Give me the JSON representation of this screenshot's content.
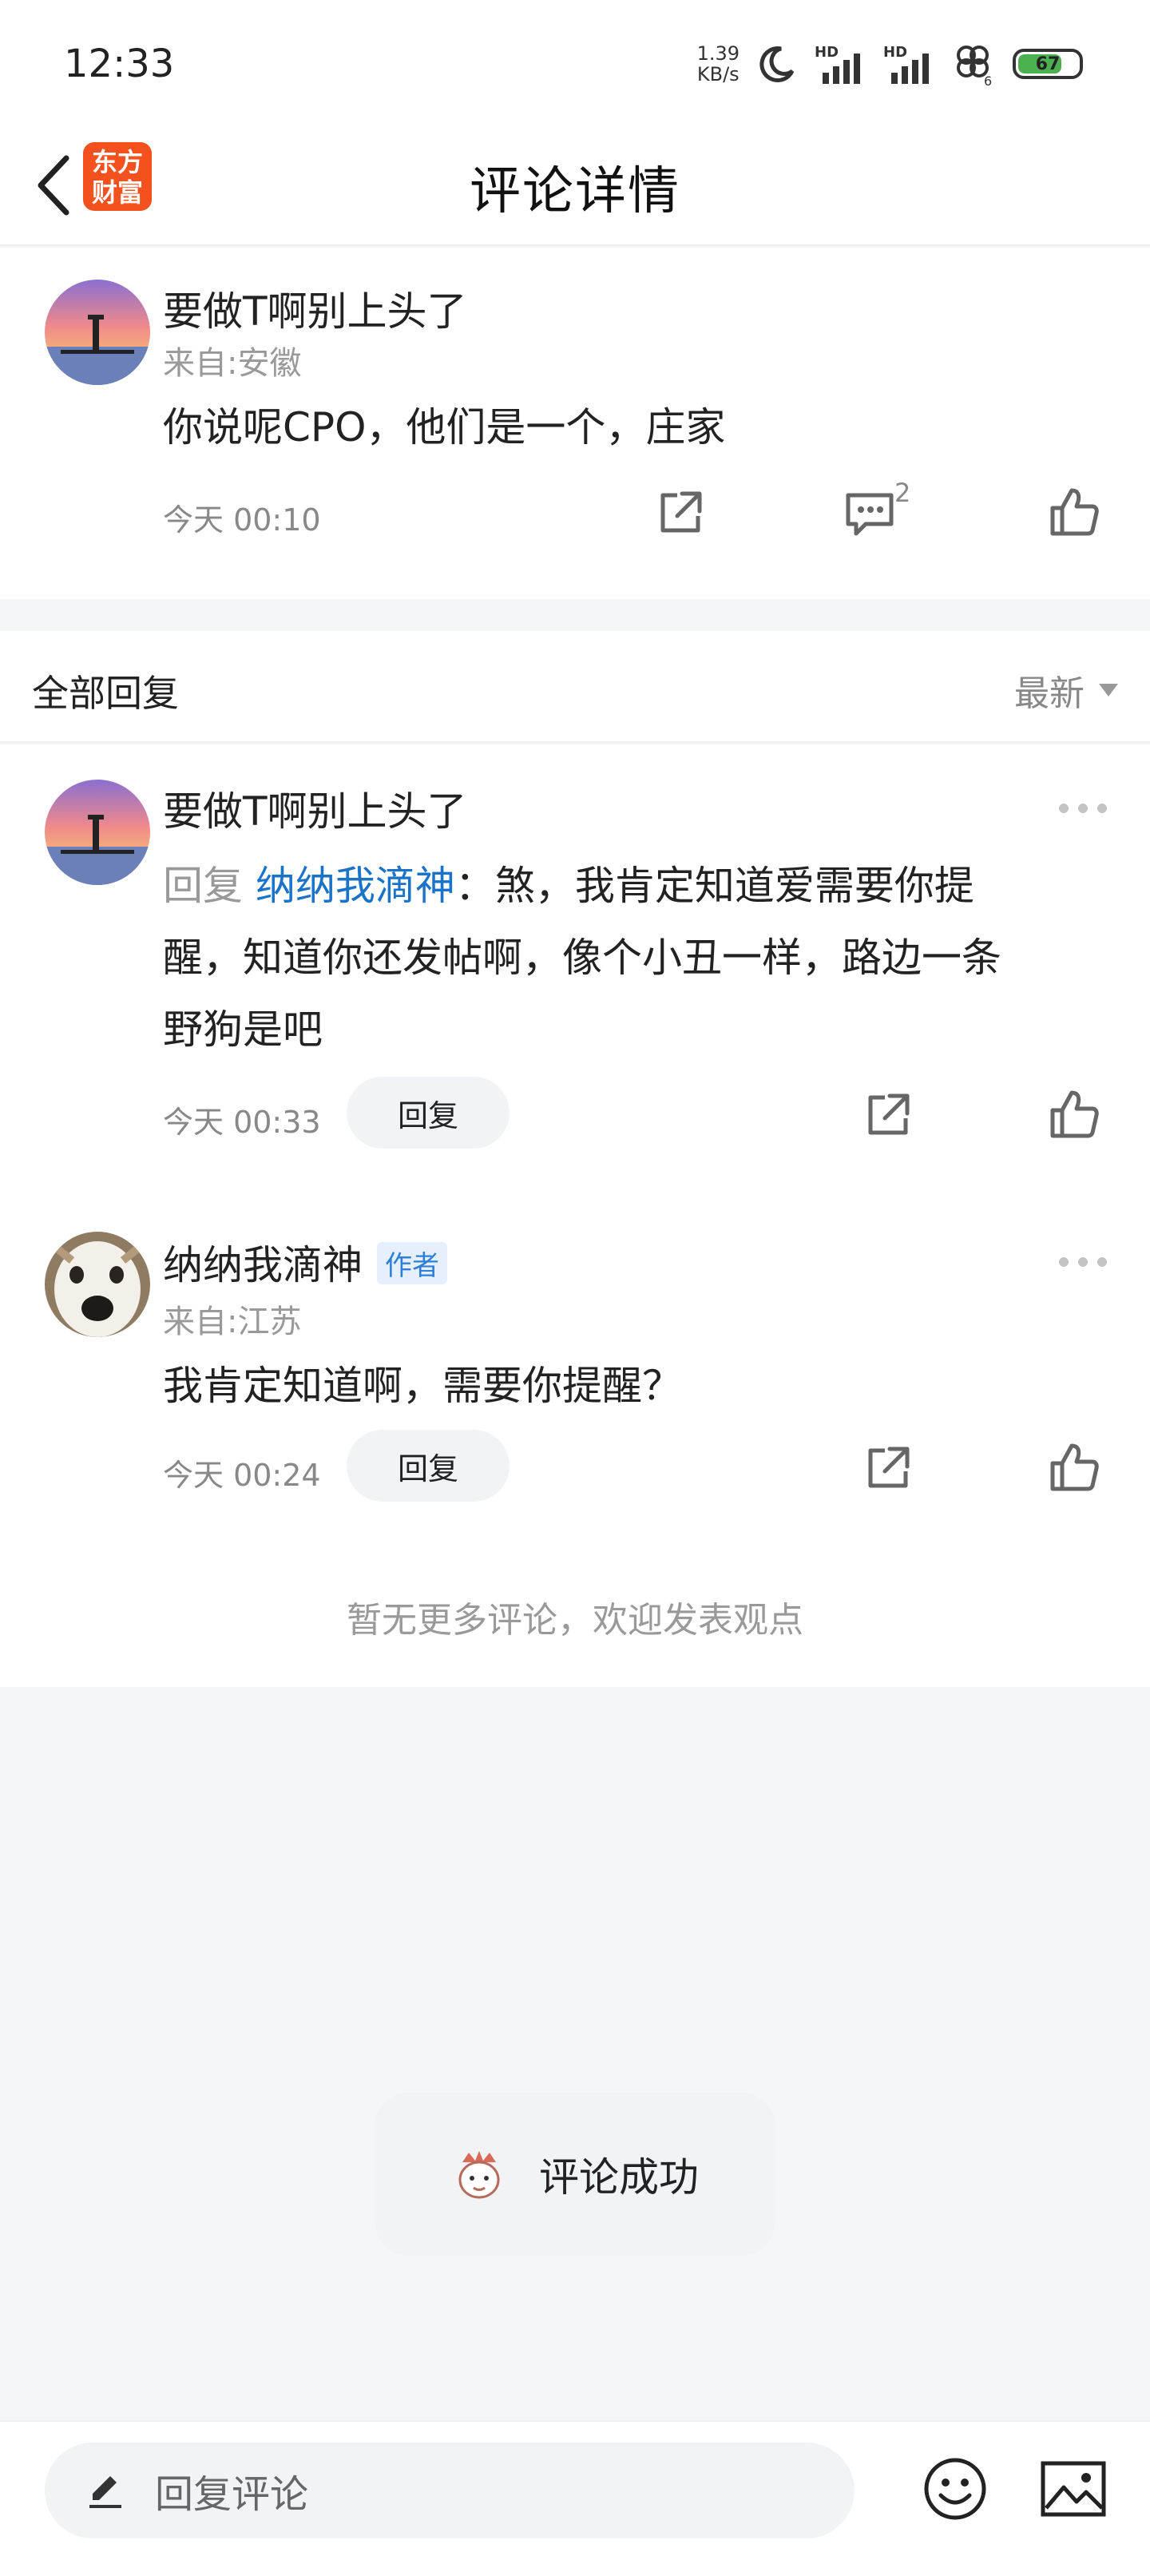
{
  "status_bar": {
    "time": "12:33",
    "speed_value": "1.39",
    "speed_unit": "KB/s",
    "hd_label": "HD",
    "battery": "67",
    "clover_badge": "6"
  },
  "header": {
    "title": "评论详情",
    "logo_line1": "东方",
    "logo_line2": "财富"
  },
  "main_comment": {
    "username": "要做T啊别上头了",
    "location": "来自:安徽",
    "text": "你说呢CPO，他们是一个，庄家",
    "time": "今天 00:10",
    "reply_count": "2"
  },
  "replies_section": {
    "title": "全部回复",
    "sort_label": "最新"
  },
  "replies": [
    {
      "username": "要做T啊别上头了",
      "reply_prefix": "回复",
      "reply_target": "纳纳我滴神",
      "text_line1": "：煞，我肯定知道爱需要你提",
      "text_line2": "醒，知道你还发帖啊，像个小丑一样，路边一条",
      "text_line3": "野狗是吧",
      "time": "今天 00:33",
      "reply_button": "回复"
    },
    {
      "username": "纳纳我滴神",
      "author_tag": "作者",
      "location": "来自:江苏",
      "text": "我肯定知道啊，需要你提醒？",
      "time": "今天 00:24",
      "reply_button": "回复"
    }
  ],
  "no_more_text": "暂无更多评论，欢迎发表观点",
  "toast": {
    "text": "评论成功"
  },
  "bottom_bar": {
    "input_placeholder": "回复评论"
  },
  "colors": {
    "brand": "#f4511e",
    "link": "#1a73c9",
    "background": "#f5f6f8"
  },
  "icons": [
    "back-arrow-icon",
    "share-icon",
    "comment-icon",
    "thumbs-up-icon",
    "more-icon",
    "pencil-icon",
    "emoji-icon",
    "image-icon"
  ]
}
